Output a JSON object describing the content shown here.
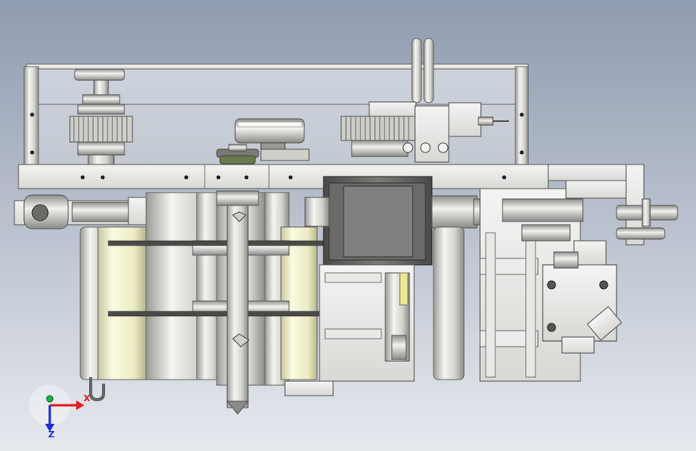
{
  "colors": {
    "bg_top": "#8f9bb0",
    "bg_bottom": "#e4e8ee",
    "metal_light": "#eeeeea",
    "metal_mid": "#c8c8c2",
    "metal_dark": "#8a8a86",
    "steel_plate": "#d9d9d4",
    "motor_dark": "#5a5a58",
    "belt_dark": "#3a3a3a",
    "roller_yellow": "#f2f0c8",
    "axis_x": "#e02020",
    "axis_y": "#20b040",
    "axis_z": "#2030d0"
  },
  "triad": {
    "x_label": "X",
    "z_label": "Z"
  }
}
